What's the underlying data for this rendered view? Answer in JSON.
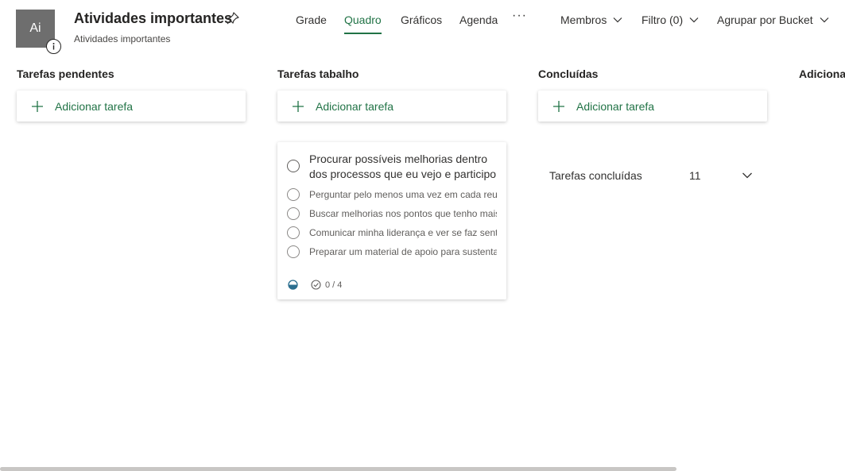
{
  "header": {
    "avatar_text": "Ai",
    "title": "Atividades importantes",
    "subtitle": "Atividades importantes",
    "more_label": "···"
  },
  "nav": {
    "tabs": [
      {
        "label": "Grade"
      },
      {
        "label": "Quadro",
        "active": true
      },
      {
        "label": "Gráficos"
      },
      {
        "label": "Agenda"
      }
    ]
  },
  "toolbar": {
    "members_label": "Membros",
    "filter_label": "Filtro (0)",
    "group_label": "Agrupar por Bucket"
  },
  "buckets": [
    {
      "title": "Tarefas pendentes",
      "add_label": "Adicionar tarefa"
    },
    {
      "title": "Tarefas tabalho",
      "add_label": "Adicionar tarefa"
    },
    {
      "title": "Concluídas",
      "add_label": "Adicionar tarefa"
    },
    {
      "title": "Adicionar"
    }
  ],
  "task": {
    "title": "Procurar possíveis melhorias dentro dos processos que eu vejo e participo",
    "checklist": [
      "Perguntar pelo menos uma vez em cada reunião",
      "Buscar melhorias nos pontos que tenho mais",
      "Comunicar minha liderança e ver se faz sentido",
      "Preparar um material de apoio para sustentar"
    ],
    "checklist_count": "0 / 4",
    "progress": "in-progress"
  },
  "completed": {
    "label": "Tarefas concluídas",
    "count": "11"
  },
  "colors": {
    "accent": "#217346",
    "avatar_bg": "#6e6e6e",
    "progress": "#2b6e8f"
  }
}
